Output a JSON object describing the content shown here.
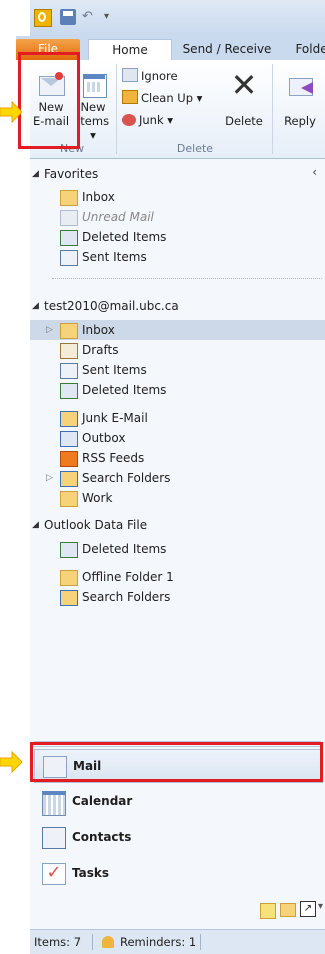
{
  "ribbon": {
    "tabs": {
      "file": "File",
      "home": "Home",
      "send_receive": "Send / Receive",
      "folder": "Folder"
    },
    "new_email_line1": "New",
    "new_email_line2": "E-mail",
    "new_items_line1": "New",
    "new_items_line2": "Items ▾",
    "group_new": "New",
    "ignore": "Ignore",
    "clean_up": "Clean Up ▾",
    "junk": "Junk ▾",
    "delete": "Delete",
    "group_delete": "Delete",
    "reply": "Reply"
  },
  "favorites": {
    "header": "Favorites",
    "items": [
      "Inbox",
      "Unread Mail",
      "Deleted Items",
      "Sent Items"
    ]
  },
  "account": {
    "header": "test2010@mail.ubc.ca",
    "items": [
      "Inbox",
      "Drafts",
      "Sent Items",
      "Deleted Items",
      "Junk E-Mail",
      "Outbox",
      "RSS Feeds",
      "Search Folders",
      "Work"
    ]
  },
  "datafile": {
    "header": "Outlook Data File",
    "items": [
      "Deleted Items",
      "Offline Folder 1",
      "Search Folders"
    ]
  },
  "navigation": {
    "mail": "Mail",
    "calendar": "Calendar",
    "contacts": "Contacts",
    "tasks": "Tasks"
  },
  "status": {
    "items": "Items: 7",
    "reminders": "Reminders: 1"
  },
  "colors": {
    "accent": "#e31c23",
    "file_tab": "#e16a0c"
  }
}
